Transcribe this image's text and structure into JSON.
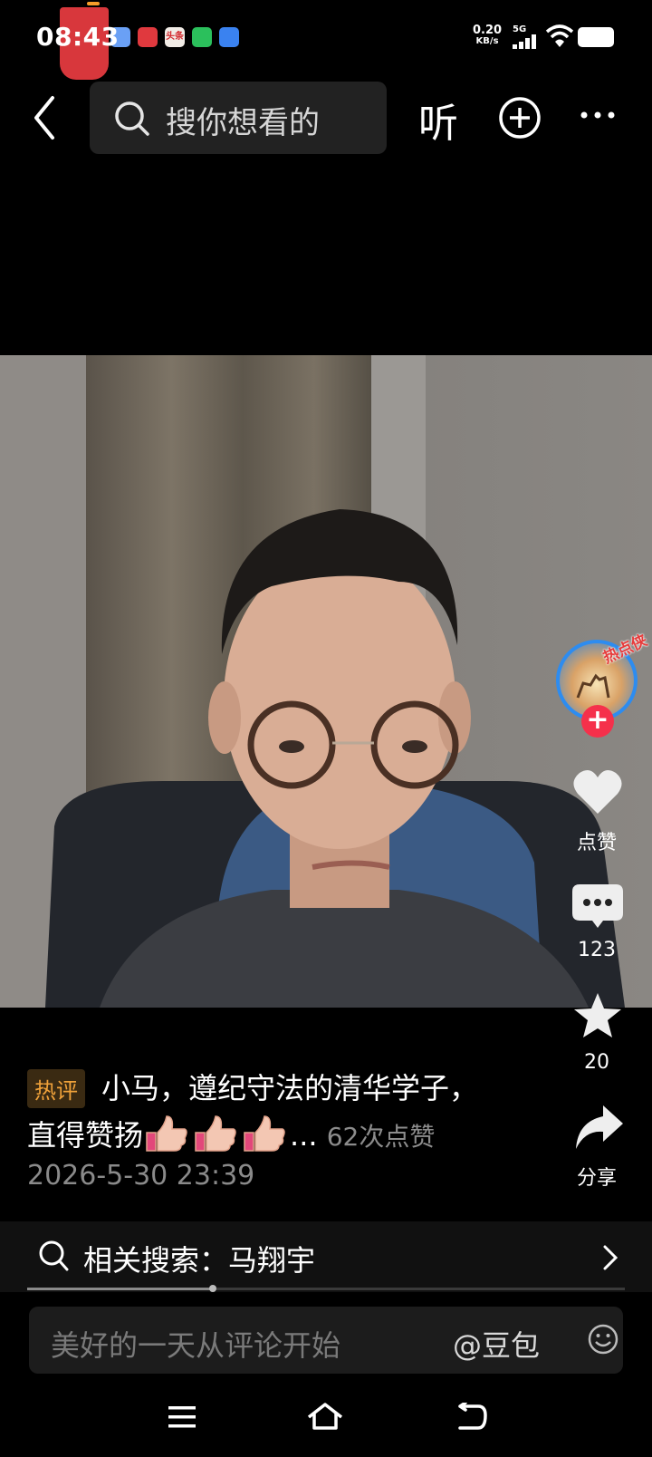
{
  "status_bar": {
    "time": "08:43",
    "net_speed_value": "0.20",
    "net_speed_unit": "KB/s",
    "network": "5G",
    "app_icons": [
      "cloud-app-icon",
      "red-app-icon",
      "toutiao-app-icon",
      "wechat-app-icon",
      "blue-app-icon"
    ],
    "toutiao_label": "头条"
  },
  "top_bar": {
    "search_placeholder": "搜你想看的",
    "listen_label": "听"
  },
  "avatar": {
    "tag": "热点侠"
  },
  "actions": {
    "like_label": "点赞",
    "comment_count": "123",
    "favorite_count": "20",
    "share_label": "分享"
  },
  "caption": {
    "badge": "热评",
    "line1": "小马，遵纪守法的清华学子，",
    "line2": "直得赞扬",
    "ellipsis": "...",
    "like_count": "62次点赞",
    "date": "2026-5-30 23:39"
  },
  "related": {
    "label": "相关搜索：马翔宇"
  },
  "progress": 0.31,
  "comment_input": {
    "placeholder": "美好的一天从评论开始",
    "mention": "@豆包"
  },
  "colors": {
    "accent_red": "#f5304b",
    "badge_text": "#f0a23a",
    "avatar_ring": "#2d8cf0"
  }
}
